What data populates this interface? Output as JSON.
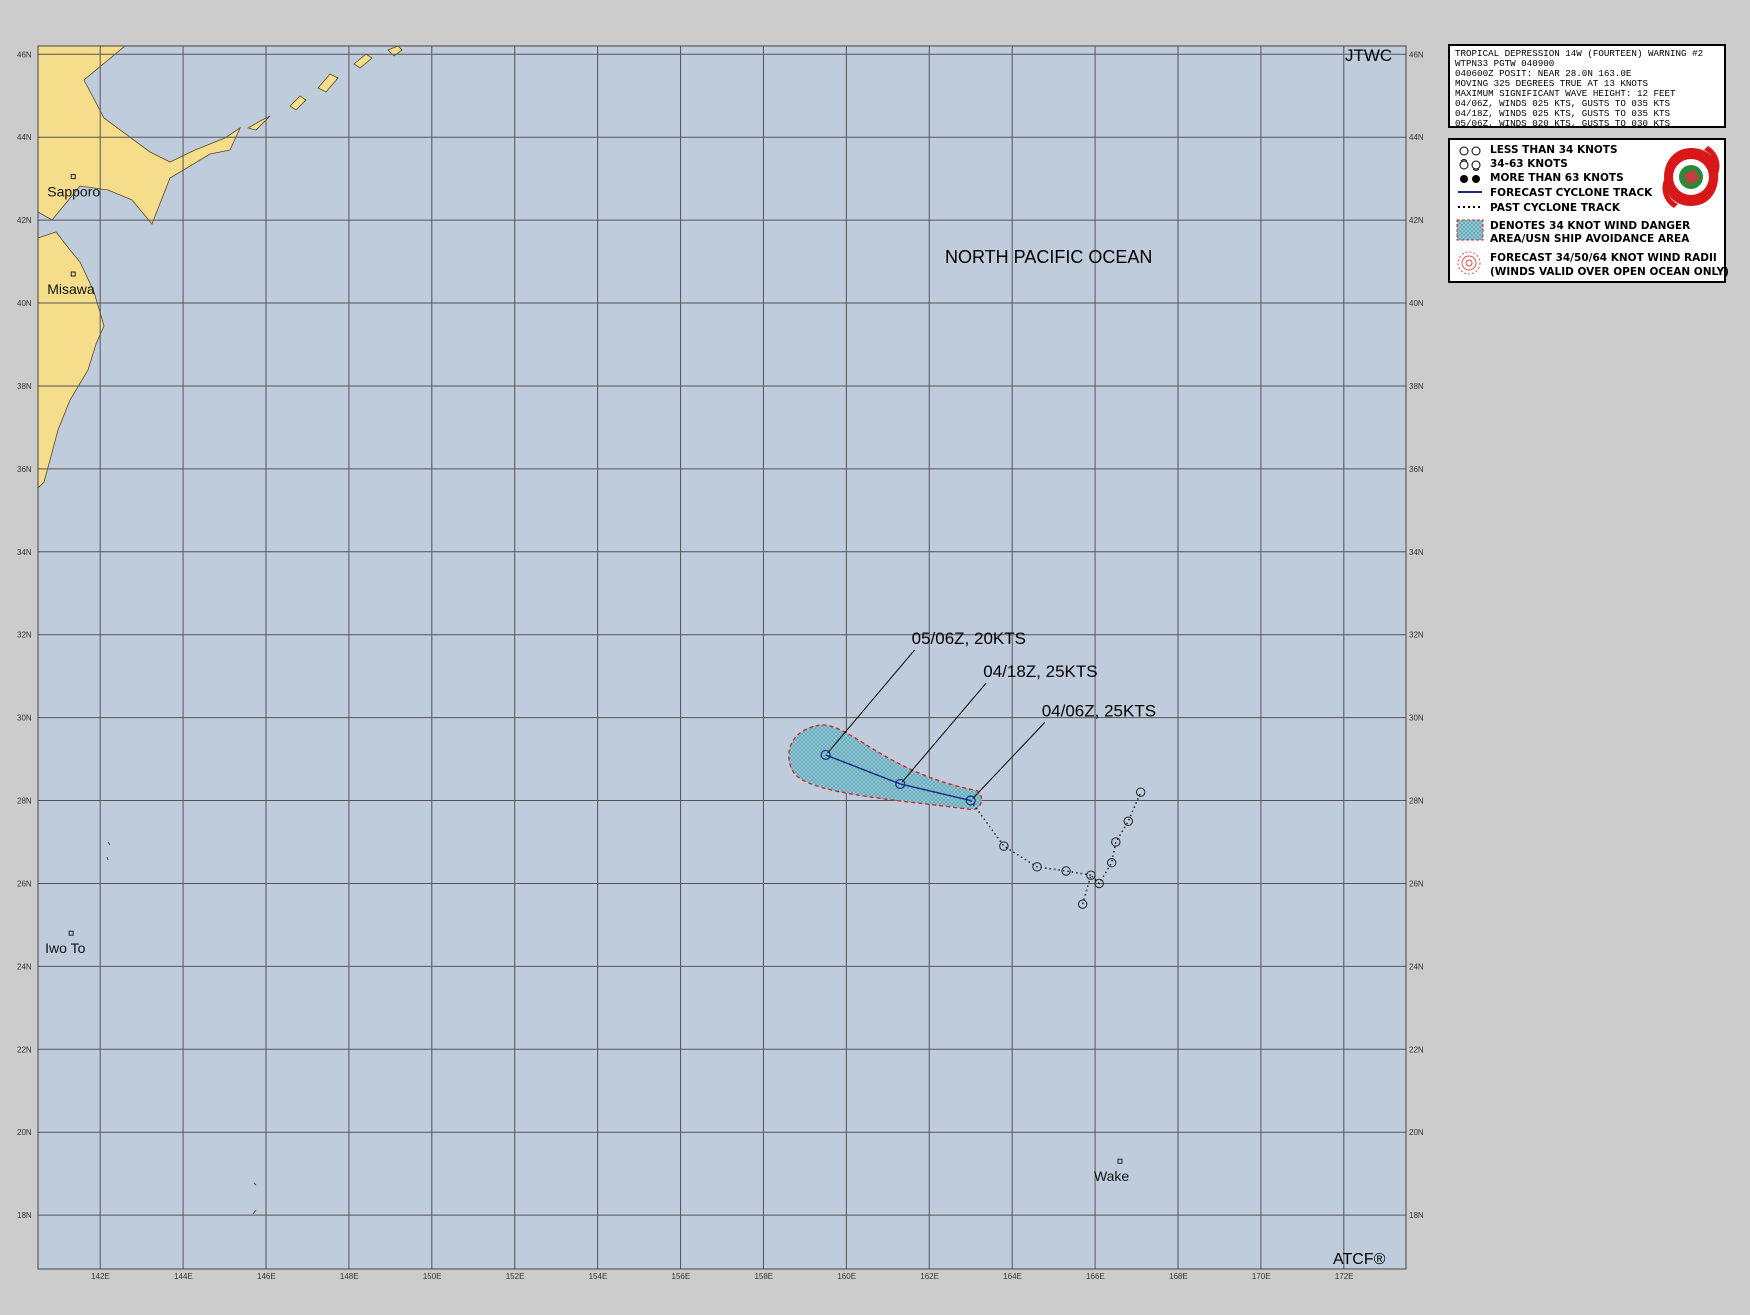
{
  "header": {
    "agency": "JTWC",
    "footer": "ATCF®"
  },
  "warning_text": [
    "TROPICAL DEPRESSION 14W (FOURTEEN) WARNING #2",
    "WTPN33 PGTW 040900",
    "040600Z POSIT: NEAR 28.0N 163.0E",
    "MOVING 325 DEGREES TRUE AT 13 KNOTS",
    "MAXIMUM SIGNIFICANT WAVE HEIGHT: 12 FEET",
    "04/06Z, WINDS 025 KTS, GUSTS TO 035 KTS",
    "04/18Z, WINDS 025 KTS, GUSTS TO 035 KTS",
    "05/06Z, WINDS 020 KTS, GUSTS TO 030 KTS"
  ],
  "legend": {
    "items": [
      "LESS THAN 34 KNOTS",
      "34-63 KNOTS",
      "MORE THAN 63 KNOTS",
      "FORECAST CYCLONE TRACK",
      "PAST CYCLONE TRACK",
      "DENOTES 34 KNOT WIND DANGER",
      "AREA/USN SHIP AVOIDANCE AREA",
      "FORECAST 34/50/64 KNOT WIND RADII",
      "(WINDS VALID OVER OPEN OCEAN ONLY)"
    ]
  },
  "map": {
    "ocean_label": "NORTH PACIFIC OCEAN",
    "lon_range": [
      140.5,
      173.5
    ],
    "lat_range": [
      16.7,
      46.2
    ],
    "lat_ticks": [
      "46N",
      "44N",
      "42N",
      "40N",
      "38N",
      "36N",
      "34N",
      "32N",
      "30N",
      "28N",
      "26N",
      "24N",
      "22N",
      "20N",
      "18N"
    ],
    "lon_ticks": [
      "142E",
      "144E",
      "146E",
      "148E",
      "150E",
      "152E",
      "154E",
      "156E",
      "158E",
      "160E",
      "162E",
      "164E",
      "166E",
      "168E",
      "170E",
      "172E"
    ],
    "places": [
      {
        "name": "Sapporo",
        "lat": 43.05,
        "lon": 141.35
      },
      {
        "name": "Misawa",
        "lat": 40.7,
        "lon": 141.35
      },
      {
        "name": "Iwo To",
        "lat": 24.8,
        "lon": 141.3
      },
      {
        "name": "Wake",
        "lat": 19.3,
        "lon": 166.6
      }
    ],
    "forecast_points": [
      {
        "label": "04/06Z,  25KTS",
        "lat": 28.0,
        "lon": 163.0
      },
      {
        "label": "04/18Z,  25KTS",
        "lat": 28.4,
        "lon": 161.3
      },
      {
        "label": "05/06Z,  20KTS",
        "lat": 29.1,
        "lon": 159.5
      }
    ],
    "past_track": [
      {
        "lat": 25.5,
        "lon": 165.7
      },
      {
        "lat": 26.2,
        "lon": 165.9
      },
      {
        "lat": 26.0,
        "lon": 166.1
      },
      {
        "lat": 26.5,
        "lon": 166.4
      },
      {
        "lat": 27.0,
        "lon": 166.5
      },
      {
        "lat": 27.5,
        "lon": 166.8
      },
      {
        "lat": 28.2,
        "lon": 167.1
      }
    ],
    "past_track_path": [
      {
        "lat": 25.5,
        "lon": 165.7
      },
      {
        "lat": 26.2,
        "lon": 165.9
      },
      {
        "lat": 26.0,
        "lon": 166.1
      },
      {
        "lat": 26.5,
        "lon": 166.4
      },
      {
        "lat": 27.0,
        "lon": 166.5
      },
      {
        "lat": 27.5,
        "lon": 166.8
      },
      {
        "lat": 28.2,
        "lon": 167.1
      }
    ],
    "past_track_west": [
      {
        "lat": 26.2,
        "lon": 165.9
      },
      {
        "lat": 26.3,
        "lon": 165.3
      },
      {
        "lat": 26.4,
        "lon": 164.6
      },
      {
        "lat": 26.9,
        "lon": 163.8
      },
      {
        "lat": 28.0,
        "lon": 163.0
      }
    ],
    "colors": {
      "ocean": "#bfccdc",
      "land": "#f5dd8c",
      "grid": "#555555",
      "forecast_track": "#1a2a88",
      "danger_border": "#e02020",
      "danger_fill": "#7fd6d6"
    }
  }
}
